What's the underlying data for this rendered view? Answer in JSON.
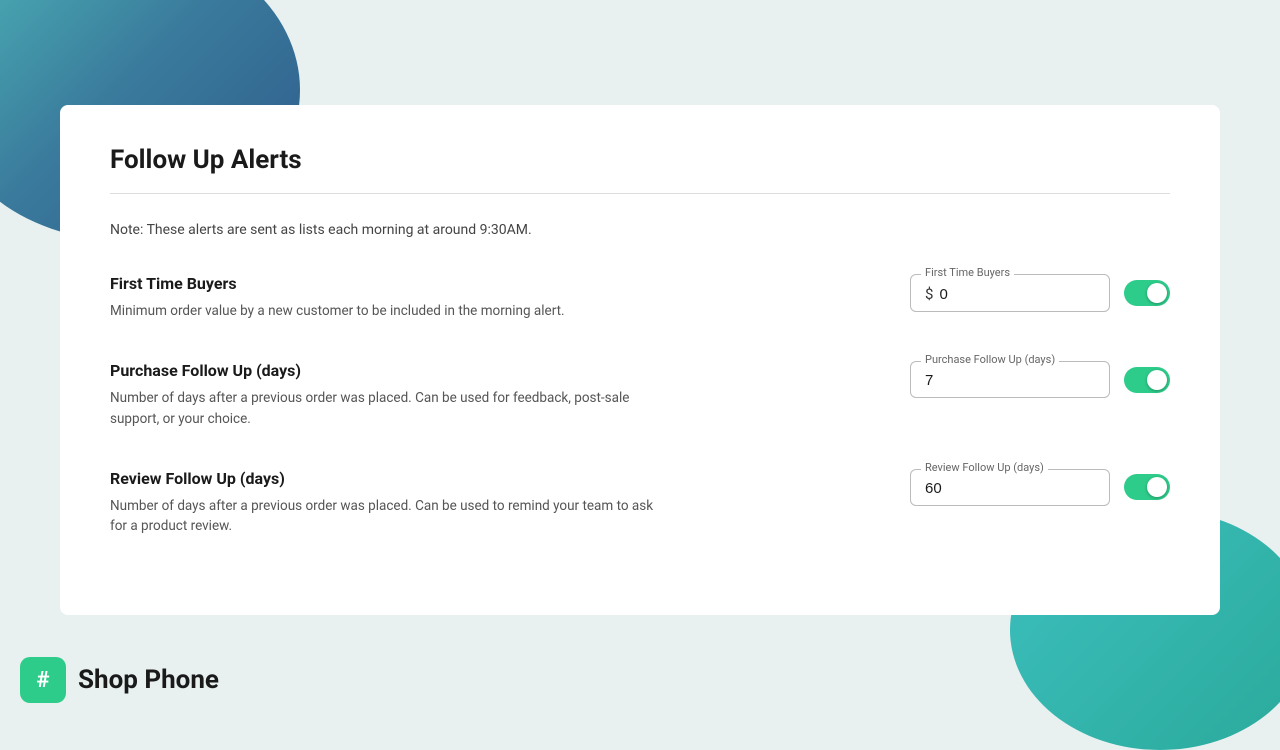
{
  "background": {
    "shape_tl": "teal-dark-gradient",
    "shape_br": "teal-gradient"
  },
  "card": {
    "title": "Follow Up Alerts",
    "note": "Note: These alerts are sent as lists each morning at around 9:30AM.",
    "divider": true
  },
  "alerts": [
    {
      "id": "first-time-buyers",
      "title": "First Time Buyers",
      "description": "Minimum order value by a new customer to be included in the morning alert.",
      "field_label": "First Time Buyers",
      "prefix": "$",
      "value": "0",
      "toggle_on": true
    },
    {
      "id": "purchase-follow-up",
      "title": "Purchase Follow Up (days)",
      "description": "Number of days after a previous order was placed. Can be used for feedback, post-sale support, or your choice.",
      "field_label": "Purchase Follow Up (days)",
      "prefix": "",
      "value": "7",
      "toggle_on": true
    },
    {
      "id": "review-follow-up",
      "title": "Review Follow Up (days)",
      "description": "Number of days after a previous order was placed. Can be used to remind your team to ask for a product review.",
      "field_label": "Review Follow Up (days)",
      "prefix": "",
      "value": "60",
      "toggle_on": true
    }
  ],
  "brand": {
    "icon": "#",
    "name": "Shop Phone"
  }
}
